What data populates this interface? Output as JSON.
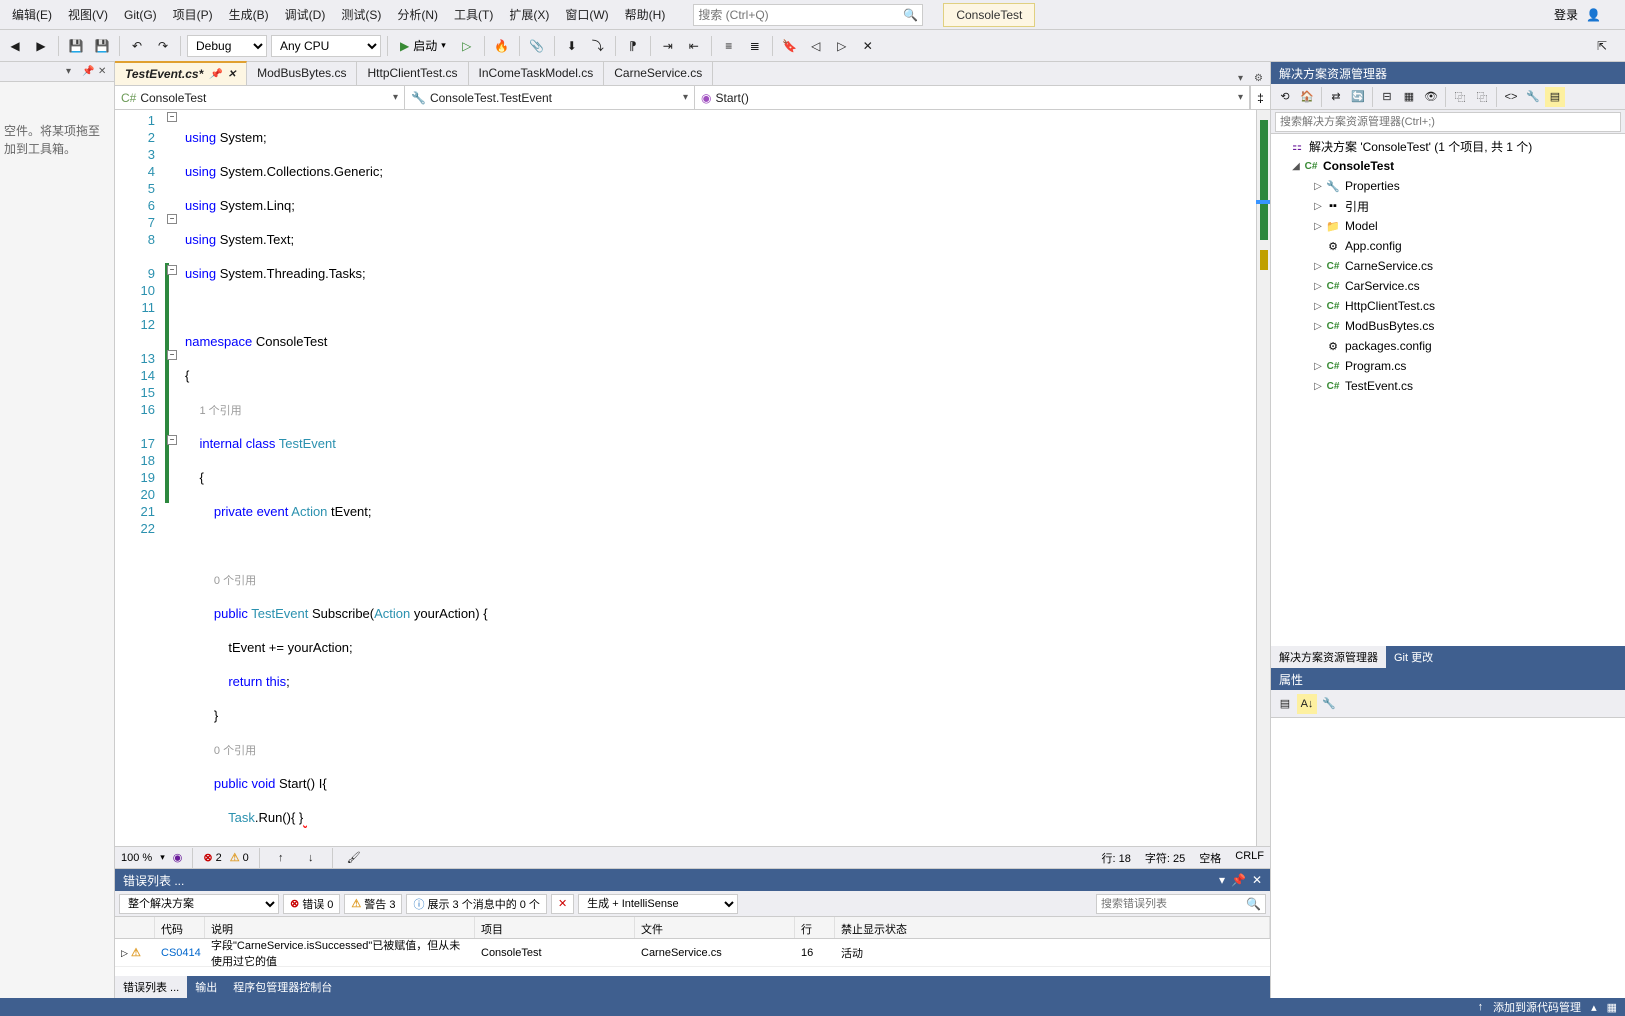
{
  "menu": {
    "items": [
      "编辑(E)",
      "视图(V)",
      "Git(G)",
      "项目(P)",
      "生成(B)",
      "调试(D)",
      "测试(S)",
      "分析(N)",
      "工具(T)",
      "扩展(X)",
      "窗口(W)",
      "帮助(H)"
    ],
    "search_placeholder": "搜索 (Ctrl+Q)",
    "app_name": "ConsoleTest",
    "login": "登录"
  },
  "toolbar": {
    "config_debug": "Debug",
    "config_cpu": "Any CPU",
    "start_label": "启动"
  },
  "left_panel": {
    "hint": "空件。将某项拖至\n加到工具箱。"
  },
  "tabs": [
    {
      "label": "TestEvent.cs*",
      "active": true,
      "pinned": true
    },
    {
      "label": "ModBusBytes.cs",
      "active": false
    },
    {
      "label": "HttpClientTest.cs",
      "active": false
    },
    {
      "label": "InComeTaskModel.cs",
      "active": false
    },
    {
      "label": "CarneService.cs",
      "active": false
    }
  ],
  "nav": {
    "project": "ConsoleTest",
    "class": "ConsoleTest.TestEvent",
    "member": "Start()"
  },
  "code": {
    "ref1": "1 个引用",
    "ref0a": "0 个引用",
    "ref0b": "0 个引用"
  },
  "editor_status": {
    "zoom": "100 %",
    "errors": "2",
    "warnings": "0",
    "line_label": "行: 18",
    "col_label": "字符: 25",
    "ins_label": "空格",
    "enc_label": "CRLF"
  },
  "bottom": {
    "title": "错误列表 ...",
    "filter_scope": "整个解决方案",
    "chip_err": "错误 0",
    "chip_warn": "警告 3",
    "chip_msg": "展示 3 个消息中的 0 个",
    "build_filter": "生成 + IntelliSense",
    "search_placeholder": "搜索错误列表",
    "cols": {
      "code": "代码",
      "desc": "说明",
      "project": "项目",
      "file": "文件",
      "line": "行",
      "suppress": "禁止显示状态"
    },
    "row": {
      "code": "CS0414",
      "desc": "字段\"CarneService.isSuccessed\"已被赋值，但从未使用过它的值",
      "project": "ConsoleTest",
      "file": "CarneService.cs",
      "line": "16",
      "suppress": "活动"
    },
    "tabs": [
      "错误列表 ...",
      "输出",
      "程序包管理器控制台"
    ]
  },
  "right": {
    "title": "解决方案资源管理器",
    "search_placeholder": "搜索解决方案资源管理器(Ctrl+;)",
    "root": "解决方案 'ConsoleTest' (1 个项目, 共 1 个)",
    "project": "ConsoleTest",
    "nodes": [
      "Properties",
      "引用",
      "Model",
      "App.config",
      "CarneService.cs",
      "CarService.cs",
      "HttpClientTest.cs",
      "ModBusBytes.cs",
      "packages.config",
      "Program.cs",
      "TestEvent.cs"
    ],
    "bottom_tabs": [
      "解决方案资源管理器",
      "Git 更改"
    ],
    "props_title": "属性"
  },
  "status_bar": {
    "add_src": "添加到源代码管理"
  }
}
